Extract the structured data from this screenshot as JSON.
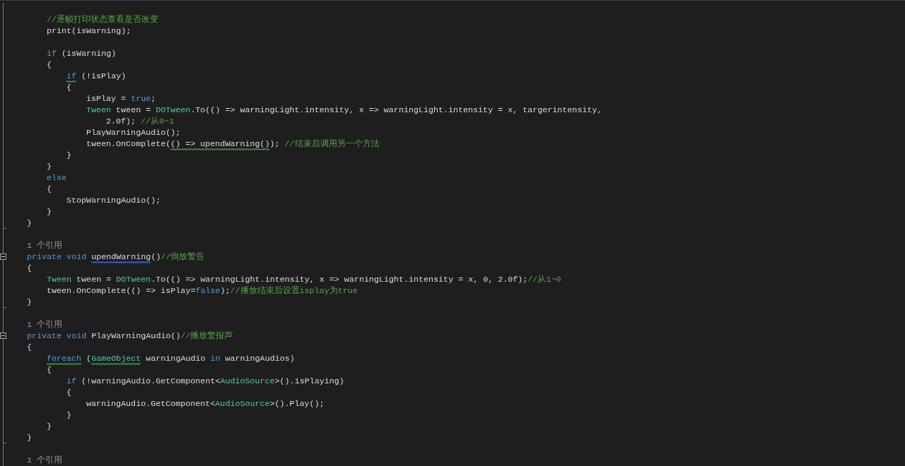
{
  "editor": {
    "lines": [
      {
        "children": [
          {
            "tokens": [
              {
                "text": "//逐帧打印状态查看是否改变",
                "kind": "comment"
              }
            ]
          },
          {
            "tokens": [
              {
                "text": "print(isWarning);",
                "kind": "plain"
              }
            ]
          },
          {
            "blank_before": true,
            "tokens": [
              {
                "text": "if",
                "kind": "keyword"
              },
              {
                "text": " (isWarning)",
                "kind": "plain"
              }
            ]
          },
          {
            "tokens": [
              {
                "text": "{",
                "kind": "plain"
              }
            ],
            "children": [
              {
                "tokens": [
                  {
                    "text": "if",
                    "kind": "keyword",
                    "color": "#3d8a3d"
                  },
                  {
                    "text": " (!isPlay)",
                    "kind": "plain"
                  }
                ]
              },
              {
                "tokens": [
                  {
                    "text": "{",
                    "kind": "plain"
                  }
                ],
                "children": [
                  {
                    "tokens": [
                      {
                        "text": "isPlay = ",
                        "kind": "plain"
                      },
                      {
                        "text": "true",
                        "kind": "keyword"
                      },
                      {
                        "text": ";",
                        "kind": "plain"
                      }
                    ]
                  },
                  {
                    "tokens": [
                      {
                        "text": "Tween",
                        "kind": "type"
                      },
                      {
                        "text": " tween = ",
                        "kind": "plain"
                      },
                      {
                        "text": "DOTween",
                        "kind": "type"
                      },
                      {
                        "text": ".To(() => warningLight.intensity, x => warningLight.intensity = x, targerintensity,",
                        "kind": "plain"
                      }
                    ],
                    "children": [
                      {
                        "tokens": [
                          {
                            "text": "2.0f); ",
                            "kind": "plain"
                          },
                          {
                            "text": "//从0~1",
                            "kind": "comment"
                          }
                        ]
                      }
                    ]
                  },
                  {
                    "tokens": [
                      {
                        "text": "PlayWarningAudio();",
                        "kind": "plain"
                      }
                    ]
                  },
                  {
                    "tokens": [
                      {
                        "text": "tween.OnComplete(",
                        "kind": "plain"
                      },
                      {
                        "text": "() => upendWarning()",
                        "kind": "plain",
                        "color": "#3d8a3d"
                      },
                      {
                        "text": "); ",
                        "kind": "plain"
                      },
                      {
                        "text": "//结束后调用另一个方法",
                        "kind": "comment"
                      }
                    ]
                  }
                ]
              },
              {
                "tokens": [
                  {
                    "text": "}",
                    "kind": "plain"
                  }
                ]
              }
            ]
          },
          {
            "tokens": [
              {
                "text": "}",
                "kind": "plain"
              }
            ]
          },
          {
            "tokens": [
              {
                "text": "else",
                "kind": "keyword"
              }
            ]
          },
          {
            "tokens": [
              {
                "text": "{",
                "kind": "plain"
              }
            ],
            "children": [
              {
                "tokens": [
                  {
                    "text": "StopWarningAudio();",
                    "kind": "plain"
                  }
                ]
              }
            ]
          },
          {
            "tokens": [
              {
                "text": "}",
                "kind": "plain"
              }
            ]
          }
        ]
      },
      {
        "tokens": [
          {
            "text": "}",
            "kind": "plain"
          }
        ],
        "block_end": true
      },
      {
        "blank_before": true,
        "tokens": [
          {
            "text": "1 个引用",
            "kind": "codelens"
          }
        ]
      },
      {
        "fold": true,
        "tokens": [
          {
            "text": "private",
            "kind": "keyword"
          },
          {
            "text": " void ",
            "kind": "keyword"
          },
          {
            "text": "upendWarning",
            "kind": "plain",
            "color": "#2b5fd9"
          },
          {
            "text": "()",
            "kind": "plain"
          },
          {
            "text": "//倒放警告",
            "kind": "comment"
          }
        ]
      },
      {
        "tokens": [
          {
            "text": "{",
            "kind": "plain"
          }
        ],
        "children": [
          {
            "tokens": [
              {
                "text": "Tween",
                "kind": "type"
              },
              {
                "text": " tween = ",
                "kind": "plain"
              },
              {
                "text": "DOTween",
                "kind": "type"
              },
              {
                "text": ".To(() => warningLight.intensity, x => warningLight.intensity = x, 0, 2.0f);",
                "kind": "plain"
              },
              {
                "text": "//从1~0",
                "kind": "comment"
              }
            ]
          },
          {
            "tokens": [
              {
                "text": "tween.OnComplete(() => isPlay=",
                "kind": "plain"
              },
              {
                "text": "false",
                "kind": "keyword"
              },
              {
                "text": ");",
                "kind": "plain"
              },
              {
                "text": "//播放结束后设置isplay为true",
                "kind": "comment"
              }
            ]
          }
        ]
      },
      {
        "tokens": [
          {
            "text": "}",
            "kind": "plain"
          }
        ],
        "block_end": true
      },
      {
        "blank_before": true,
        "tokens": [
          {
            "text": "1 个引用",
            "kind": "codelens"
          }
        ]
      },
      {
        "fold": true,
        "tokens": [
          {
            "text": "private",
            "kind": "keyword"
          },
          {
            "text": " void",
            "kind": "keyword"
          },
          {
            "text": " PlayWarningAudio()",
            "kind": "plain"
          },
          {
            "text": "//播放警报声",
            "kind": "comment"
          }
        ]
      },
      {
        "tokens": [
          {
            "text": "{",
            "kind": "plain"
          }
        ],
        "children": [
          {
            "tokens": [
              {
                "text": "foreach",
                "kind": "keyword",
                "color": "#3d8a3d"
              },
              {
                "text": " (",
                "kind": "plain"
              },
              {
                "text": "GameObject",
                "kind": "type",
                "color": "#3d8a3d"
              },
              {
                "text": " warningAudio ",
                "kind": "plain"
              },
              {
                "text": "in",
                "kind": "keyword"
              },
              {
                "text": " warningAudios)",
                "kind": "plain"
              }
            ]
          },
          {
            "tokens": [
              {
                "text": "{",
                "kind": "plain"
              }
            ],
            "children": [
              {
                "tokens": [
                  {
                    "text": "if",
                    "kind": "keyword"
                  },
                  {
                    "text": " (!warningAudio.GetComponent<",
                    "kind": "plain"
                  },
                  {
                    "text": "AudioSource",
                    "kind": "type"
                  },
                  {
                    "text": ">().isPlaying)",
                    "kind": "plain"
                  }
                ]
              },
              {
                "tokens": [
                  {
                    "text": "{",
                    "kind": "plain"
                  }
                ],
                "children": [
                  {
                    "tokens": [
                      {
                        "text": "warningAudio.GetComponent<",
                        "kind": "plain"
                      },
                      {
                        "text": "AudioSource",
                        "kind": "type"
                      },
                      {
                        "text": ">().Play();",
                        "kind": "plain"
                      }
                    ]
                  }
                ]
              },
              {
                "tokens": [
                  {
                    "text": "}",
                    "kind": "plain"
                  }
                ]
              }
            ]
          },
          {
            "tokens": [
              {
                "text": "}",
                "kind": "plain"
              }
            ]
          }
        ]
      },
      {
        "tokens": [
          {
            "text": "}",
            "kind": "plain"
          }
        ],
        "block_end": true
      },
      {
        "blank_before": true,
        "tokens": [
          {
            "text": "1 个引用",
            "kind": "codelens"
          }
        ]
      }
    ]
  }
}
